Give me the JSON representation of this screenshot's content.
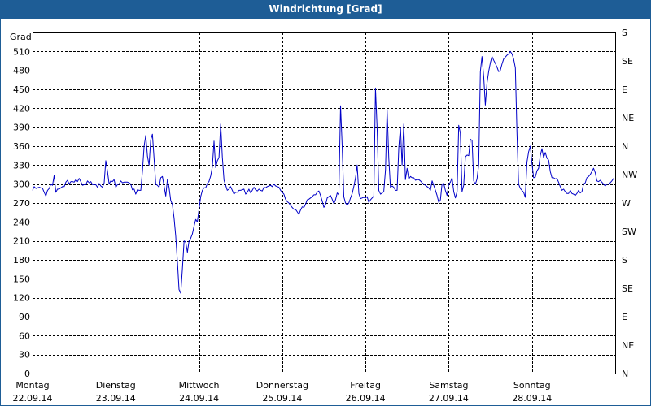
{
  "colors": {
    "titlebar": "#1e5d96",
    "line": "#0000c8",
    "grid": "#000000"
  },
  "chart_data": {
    "type": "line",
    "title": "Windrichtung [Grad]",
    "ylabel": "Grad",
    "ylim": [
      0,
      540
    ],
    "xlim": [
      0,
      7
    ],
    "yticks": [
      0,
      30,
      60,
      90,
      120,
      150,
      180,
      210,
      240,
      270,
      300,
      330,
      360,
      390,
      420,
      450,
      480,
      510
    ],
    "right_labels": [
      "N",
      "NE",
      "E",
      "SE",
      "S",
      "SW",
      "W",
      "NW",
      "N",
      "NE",
      "E",
      "SE",
      "S"
    ],
    "x_labels": [
      {
        "day": "Montag",
        "date": "22.09.14"
      },
      {
        "day": "Dienstag",
        "date": "23.09.14"
      },
      {
        "day": "Mittwoch",
        "date": "24.09.14"
      },
      {
        "day": "Donnerstag",
        "date": "25.09.14"
      },
      {
        "day": "Freitag",
        "date": "26.09.14"
      },
      {
        "day": "Samstag",
        "date": "27.09.14"
      },
      {
        "day": "Sonntag",
        "date": "28.09.14"
      }
    ],
    "grid": true,
    "series": [
      {
        "x": [
          0.0,
          0.02,
          0.04,
          0.06,
          0.08,
          0.1,
          0.12,
          0.14,
          0.16,
          0.18,
          0.2,
          0.22,
          0.24,
          0.26,
          0.28,
          0.3,
          0.32,
          0.34,
          0.36,
          0.38,
          0.4,
          0.42,
          0.44,
          0.46,
          0.48,
          0.5,
          0.52,
          0.54,
          0.56,
          0.58,
          0.6,
          0.62,
          0.64,
          0.66,
          0.68,
          0.7,
          0.72,
          0.74,
          0.76,
          0.78,
          0.8,
          0.82,
          0.84,
          0.86,
          0.88,
          0.9,
          0.92,
          0.94,
          0.96,
          0.98,
          1.0,
          1.02,
          1.04,
          1.06,
          1.08,
          1.1,
          1.12,
          1.14,
          1.16,
          1.18,
          1.2,
          1.22,
          1.24,
          1.26,
          1.28,
          1.3,
          1.32,
          1.34,
          1.36,
          1.38,
          1.4,
          1.42,
          1.44,
          1.46,
          1.48,
          1.5,
          1.52,
          1.54,
          1.56,
          1.58,
          1.6,
          1.62,
          1.64,
          1.66,
          1.68,
          1.7,
          1.72,
          1.74,
          1.76,
          1.78,
          1.8,
          1.82,
          1.84,
          1.86,
          1.88,
          1.9,
          1.92,
          1.94,
          1.96,
          1.98,
          2.0,
          2.02,
          2.04,
          2.06,
          2.08,
          2.1,
          2.12,
          2.14,
          2.16,
          2.18,
          2.2,
          2.22,
          2.24,
          2.26,
          2.28,
          2.3,
          2.32,
          2.34,
          2.36,
          2.38,
          2.4,
          2.42,
          2.44,
          2.46,
          2.48,
          2.5,
          2.52,
          2.54,
          2.56,
          2.58,
          2.6,
          2.62,
          2.64,
          2.66,
          2.68,
          2.7,
          2.72,
          2.74,
          2.76,
          2.78,
          2.8,
          2.82,
          2.84,
          2.86,
          2.88,
          2.9,
          2.92,
          2.94,
          2.96,
          2.98,
          3.0,
          3.02,
          3.04,
          3.06,
          3.08,
          3.1,
          3.12,
          3.14,
          3.16,
          3.18,
          3.2,
          3.22,
          3.24,
          3.26,
          3.28,
          3.3,
          3.32,
          3.34,
          3.36,
          3.38,
          3.4,
          3.42,
          3.44,
          3.46,
          3.48,
          3.5,
          3.52,
          3.54,
          3.56,
          3.58,
          3.6,
          3.62,
          3.64,
          3.66,
          3.68,
          3.7,
          3.72,
          3.74,
          3.76,
          3.78,
          3.8,
          3.82,
          3.84,
          3.86,
          3.88,
          3.9,
          3.92,
          3.94,
          3.96,
          3.98,
          4.0,
          4.02,
          4.04,
          4.06,
          4.08,
          4.1,
          4.12,
          4.14,
          4.16,
          4.18,
          4.2,
          4.22,
          4.24,
          4.26,
          4.28,
          4.3,
          4.32,
          4.34,
          4.36,
          4.38,
          4.4,
          4.42,
          4.44,
          4.46,
          4.48,
          4.5,
          4.52,
          4.54,
          4.56,
          4.58,
          4.6,
          4.62,
          4.64,
          4.66,
          4.68,
          4.7,
          4.72,
          4.74,
          4.76,
          4.78,
          4.8,
          4.82,
          4.84,
          4.86,
          4.88,
          4.9,
          4.92,
          4.94,
          4.96,
          4.98,
          5.0,
          5.02,
          5.04,
          5.06,
          5.08,
          5.1,
          5.12,
          5.14,
          5.16,
          5.18,
          5.2,
          5.22,
          5.24,
          5.26,
          5.28,
          5.3,
          5.32,
          5.34,
          5.36,
          5.38,
          5.4,
          5.42,
          5.44,
          5.46,
          5.48,
          5.5,
          5.52,
          5.54,
          5.56,
          5.58,
          5.6,
          5.62,
          5.64,
          5.66,
          5.68,
          5.7,
          5.72,
          5.74,
          5.76,
          5.78,
          5.8,
          5.82,
          5.84,
          5.86,
          5.88,
          5.9,
          5.92,
          5.94,
          5.96,
          5.98,
          6.0,
          6.02,
          6.04,
          6.06,
          6.08,
          6.1,
          6.12,
          6.14,
          6.16,
          6.18,
          6.2,
          6.22,
          6.24,
          6.26,
          6.28,
          6.3,
          6.32,
          6.34,
          6.36,
          6.38,
          6.4,
          6.42,
          6.44,
          6.46,
          6.48,
          6.5,
          6.52,
          6.54,
          6.56,
          6.58,
          6.6,
          6.62,
          6.64,
          6.66,
          6.68,
          6.7,
          6.72,
          6.74,
          6.76,
          6.78,
          6.8,
          6.82,
          6.84,
          6.86,
          6.88,
          6.9,
          6.92,
          6.94,
          6.96,
          6.98
        ],
        "values": [
          290,
          296,
          293,
          294,
          295,
          294,
          293,
          287,
          281,
          290,
          293,
          300,
          298,
          314,
          287,
          292,
          292,
          294,
          296,
          296,
          303,
          306,
          300,
          304,
          304,
          303,
          307,
          304,
          309,
          304,
          298,
          299,
          299,
          305,
          302,
          304,
          299,
          299,
          299,
          295,
          301,
          297,
          295,
          302,
          337,
          320,
          300,
          305,
          304,
          307,
          295,
          299,
          300,
          305,
          302,
          303,
          303,
          303,
          302,
          300,
          291,
          292,
          284,
          291,
          290,
          290,
          320,
          360,
          377,
          344,
          330,
          370,
          379,
          341,
          300,
          298,
          295,
          310,
          312,
          297,
          281,
          307,
          295,
          274,
          268,
          246,
          218,
          177,
          133,
          127,
          165,
          210,
          208,
          192,
          210,
          214,
          221,
          233,
          244,
          240,
          260,
          280,
          290,
          294,
          294,
          301,
          304,
          313,
          327,
          368,
          326,
          337,
          342,
          395,
          343,
          306,
          298,
          290,
          292,
          296,
          290,
          284,
          287,
          287,
          290,
          290,
          291,
          292,
          284,
          287,
          292,
          286,
          290,
          295,
          291,
          289,
          292,
          290,
          289,
          295,
          294,
          296,
          297,
          298,
          296,
          300,
          297,
          296,
          295,
          290,
          287,
          284,
          276,
          272,
          270,
          266,
          263,
          260,
          260,
          256,
          252,
          259,
          264,
          263,
          268,
          275,
          276,
          278,
          280,
          283,
          283,
          287,
          289,
          282,
          273,
          263,
          267,
          278,
          280,
          282,
          276,
          269,
          275,
          286,
          283,
          424,
          360,
          280,
          270,
          267,
          270,
          278,
          285,
          296,
          310,
          330,
          285,
          277,
          278,
          279,
          278,
          280,
          271,
          275,
          278,
          281,
          452,
          386,
          290,
          284,
          286,
          288,
          322,
          418,
          340,
          295,
          297,
          295,
          290,
          290,
          359,
          390,
          330,
          395,
          307,
          325,
          308,
          312,
          310,
          310,
          306,
          307,
          307,
          305,
          302,
          300,
          298,
          296,
          294,
          290,
          305,
          298,
          290,
          282,
          271,
          275,
          300,
          301,
          290,
          282,
          300,
          303,
          310,
          288,
          278,
          288,
          393,
          381,
          288,
          298,
          343,
          346,
          345,
          371,
          369,
          305,
          300,
          308,
          331,
          478,
          502,
          470,
          425,
          460,
          478,
          492,
          502,
          496,
          491,
          485,
          478,
          480,
          490,
          498,
          501,
          504,
          506,
          510,
          506,
          498,
          484,
          380,
          300,
          293,
          290,
          287,
          279,
          335,
          351,
          360,
          333,
          310,
          311,
          321,
          325,
          345,
          356,
          342,
          350,
          341,
          338,
          320,
          310,
          310,
          308,
          309,
          303,
          296,
          290,
          292,
          288,
          285,
          285,
          290,
          285,
          284,
          282,
          285,
          290,
          286,
          288,
          300,
          302,
          310,
          312,
          315,
          320,
          325,
          318,
          305,
          304,
          306,
          303,
          300,
          297,
          300,
          300,
          302,
          305,
          309
        ]
      }
    ]
  }
}
